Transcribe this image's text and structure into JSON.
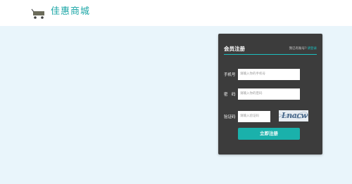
{
  "header": {
    "brand": "佳惠商城",
    "logo_icon": "cart-icon"
  },
  "register": {
    "title": "会员注册",
    "login_prompt": "我已有账号?",
    "login_link": "请登录",
    "phone_label": "手机号",
    "phone_placeholder": "请输入你的手机号",
    "password_label": "密　码",
    "password_placeholder": "请输入你的密码",
    "captcha_label": "验证码",
    "captcha_placeholder": "请输入验证码",
    "captcha_image_text": "Lnacw",
    "submit_label": "立即注册"
  },
  "colors": {
    "accent": "#1ab1ab",
    "panel": "#3c3c3c",
    "hero_background": "#e9f5fb"
  }
}
